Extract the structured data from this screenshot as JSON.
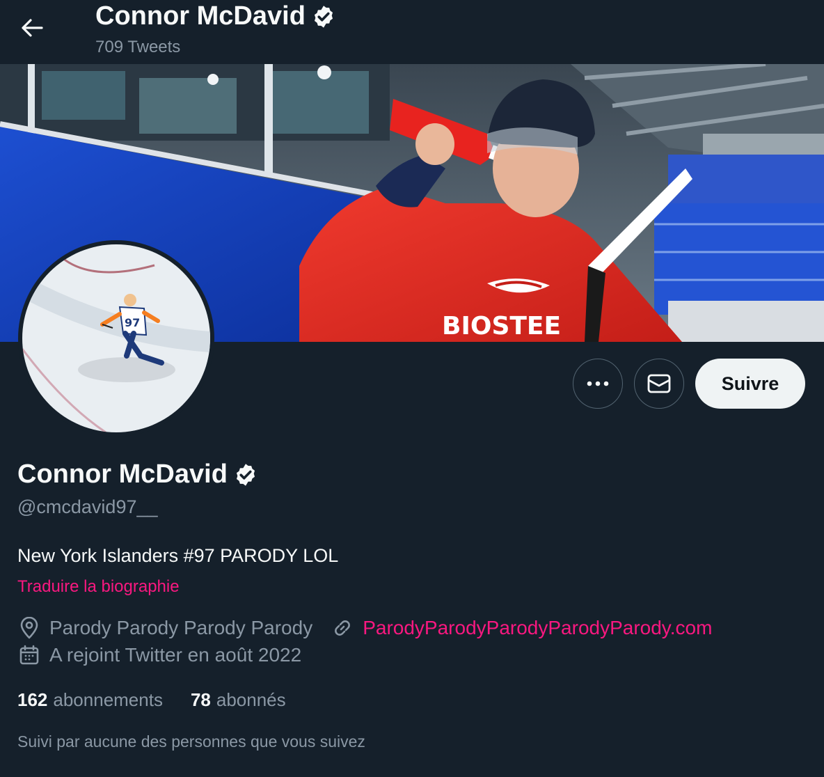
{
  "header": {
    "title": "Connor McDavid",
    "tweet_count": "709 Tweets"
  },
  "profile": {
    "name": "Connor McDavid",
    "handle": "@cmcdavid97__",
    "bio": "New York Islanders #97 PARODY LOL",
    "translate_bio": "Traduire la biographie",
    "location": "Parody Parody Parody Parody",
    "website": "ParodyParodyParodyParodyParody.com",
    "joined": "A rejoint Twitter en août 2022",
    "following_count": "162",
    "following_label": "abonnements",
    "followers_count": "78",
    "followers_label": "abonnés",
    "followed_by": "Suivi par aucune des personnes que vous suivez"
  },
  "actions": {
    "follow_label": "Suivre"
  },
  "colors": {
    "background": "#15202b",
    "accent": "#f91880",
    "muted_text": "#8b98a5",
    "button_bg": "#eff3f4"
  },
  "icons": {
    "back": "arrow-left-icon",
    "verified": "verified-badge-icon",
    "more": "more-dots-icon",
    "message": "envelope-icon",
    "location": "map-pin-icon",
    "link": "link-icon",
    "calendar": "calendar-icon"
  }
}
